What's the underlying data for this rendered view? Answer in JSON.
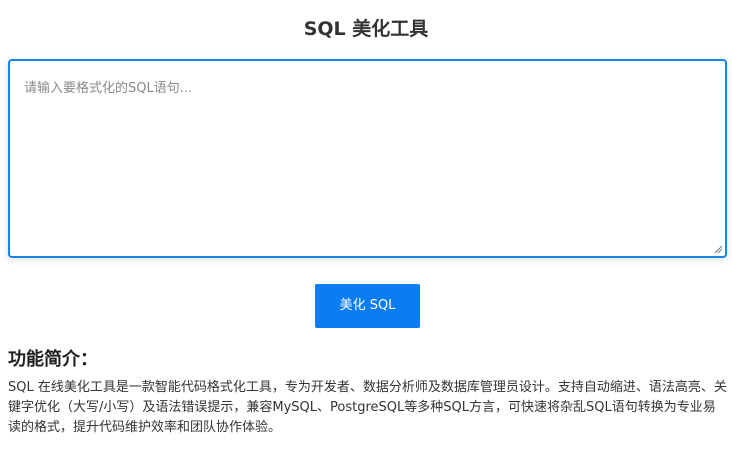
{
  "page": {
    "title": "SQL 美化工具"
  },
  "editor": {
    "placeholder": "请输入要格式化的SQL语句...",
    "value": ""
  },
  "actions": {
    "beautify_label": "美化 SQL"
  },
  "intro": {
    "heading": "功能简介：",
    "text": "SQL 在线美化工具是一款智能代码格式化工具，专为开发者、数据分析师及数据库管理员设计。支持自动缩进、语法高亮、关键字优化（大写/小写）及语法错误提示，兼容MySQL、PostgreSQL等多种SQL方言，可快速将杂乱SQL语句转换为专业易读的格式，提升代码维护效率和团队协作体验。"
  },
  "colors": {
    "accent": "#0a7cf4",
    "focus_border": "#1a85e8",
    "text": "#333333",
    "placeholder": "#8a8a8a"
  }
}
